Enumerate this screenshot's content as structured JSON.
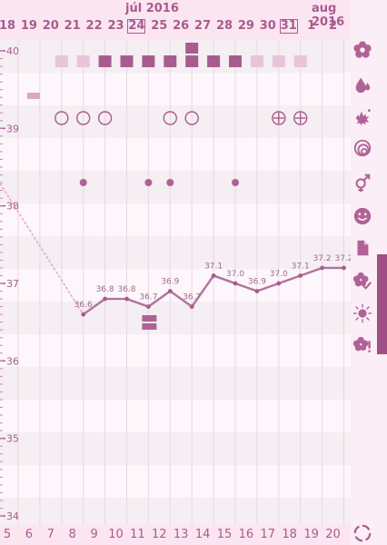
{
  "header": {
    "months": [
      {
        "label": "júl 2016"
      },
      {
        "label": "aug 2016"
      }
    ],
    "days": [
      "18",
      "19",
      "20",
      "21",
      "22",
      "23",
      "24",
      "25",
      "26",
      "27",
      "28",
      "29",
      "30",
      "31",
      "1",
      "2"
    ],
    "today_day": "24",
    "boxed_day": "31"
  },
  "y_axis": {
    "labels": [
      "40",
      "39",
      "38",
      "37",
      "36",
      "35",
      "34"
    ]
  },
  "cycle_days": [
    "5",
    "6",
    "7",
    "8",
    "9",
    "10",
    "11",
    "12",
    "13",
    "14",
    "15",
    "16",
    "17",
    "18",
    "19",
    "20"
  ],
  "chart_data": {
    "type": "line",
    "x": [
      "21",
      "22",
      "23",
      "24",
      "25",
      "26",
      "27",
      "28",
      "29",
      "30",
      "31",
      "1",
      "2"
    ],
    "values": [
      36.6,
      36.8,
      36.8,
      36.7,
      36.9,
      36.7,
      37.1,
      37.0,
      36.9,
      37.0,
      37.1,
      37.2,
      37.2
    ],
    "labels": [
      "36.6",
      "36.8",
      "36.8",
      "36.7",
      "36.9",
      "36.7",
      "37.1",
      "37.0",
      "36.9",
      "37.0",
      "37.1",
      "37.2",
      "37.2"
    ],
    "ylim": [
      34,
      40
    ],
    "grid": true
  },
  "colors": {
    "accent": "#a85c8e",
    "light": "#e8c4da",
    "line": "#b073a0"
  },
  "side_icons": [
    "flower-icon",
    "drop-icon",
    "splash-icon",
    "rings-icon",
    "gender-icon",
    "smiley-icon",
    "document-icon",
    "flower-check-icon",
    "sun-icon",
    "flower-alert-icon",
    "refresh-icon"
  ]
}
